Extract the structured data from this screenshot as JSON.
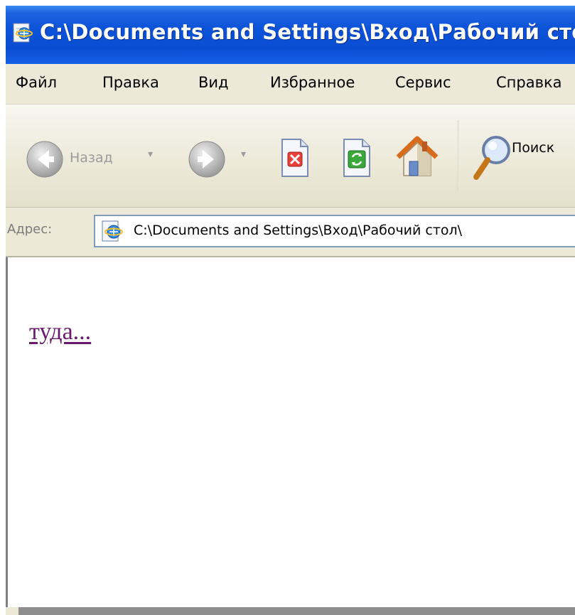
{
  "window": {
    "title": "C:\\Documents and Settings\\Вход\\Рабочий стол"
  },
  "menu": {
    "items": [
      "Файл",
      "Правка",
      "Вид",
      "Избранное",
      "Сервис",
      "Справка"
    ]
  },
  "toolbar": {
    "back_label": "Назад",
    "search_label": "Поиск",
    "icons": [
      "back-arrow-icon",
      "forward-arrow-icon",
      "stop-icon",
      "refresh-icon",
      "home-icon",
      "search-icon"
    ]
  },
  "address": {
    "label": "Адрес:",
    "value": "C:\\Documents and Settings\\Вход\\Рабочий стол\\"
  },
  "content": {
    "link_text": "туда..."
  },
  "colors": {
    "titlebar": "#0b52d8",
    "visited_link": "#6a1a6e",
    "chrome": "#ece9d8"
  }
}
